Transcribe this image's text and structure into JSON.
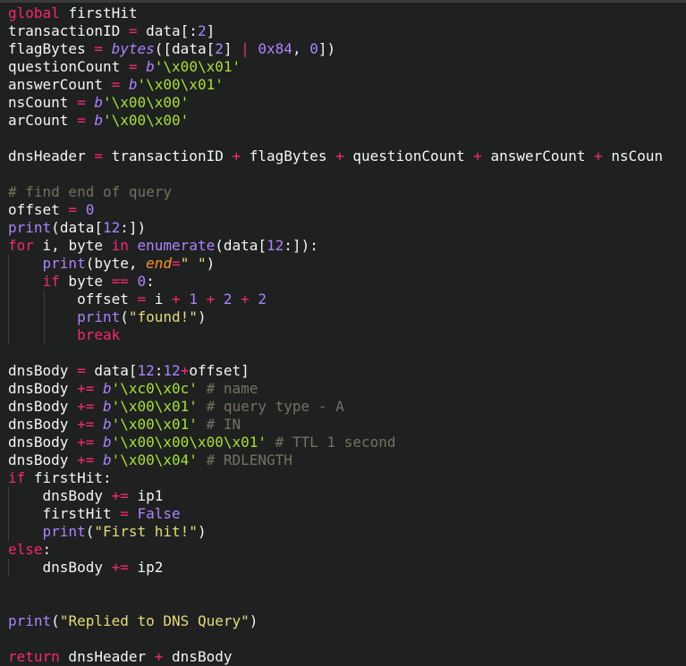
{
  "editor": {
    "language": "python",
    "theme": {
      "background": "#1f2121",
      "keyword": "#f92672",
      "identifier": "#f5f5f2",
      "number": "#ae81ff",
      "string": "#e6db74",
      "bytes_literal": "#a6e22e",
      "comment": "#75715e",
      "parameter": "#fd971f"
    },
    "lines": [
      {
        "indent": 0,
        "tokens": [
          {
            "t": "global",
            "c": "kw"
          },
          {
            "t": " ",
            "c": "pun"
          },
          {
            "t": "firstHit",
            "c": "id"
          }
        ]
      },
      {
        "indent": 0,
        "tokens": [
          {
            "t": "transactionID",
            "c": "id"
          },
          {
            "t": " = ",
            "c": "op"
          },
          {
            "t": "data",
            "c": "id"
          },
          {
            "t": "[:",
            "c": "pun"
          },
          {
            "t": "2",
            "c": "num"
          },
          {
            "t": "]",
            "c": "pun"
          }
        ]
      },
      {
        "indent": 0,
        "tokens": [
          {
            "t": "flagBytes",
            "c": "id"
          },
          {
            "t": " = ",
            "c": "op"
          },
          {
            "t": "bytes",
            "c": "bpre"
          },
          {
            "t": "([",
            "c": "pun"
          },
          {
            "t": "data",
            "c": "id"
          },
          {
            "t": "[",
            "c": "pun"
          },
          {
            "t": "2",
            "c": "num"
          },
          {
            "t": "] ",
            "c": "pun"
          },
          {
            "t": "|",
            "c": "op"
          },
          {
            "t": " ",
            "c": "pun"
          },
          {
            "t": "0x84",
            "c": "num"
          },
          {
            "t": ", ",
            "c": "pun"
          },
          {
            "t": "0",
            "c": "num"
          },
          {
            "t": "])",
            "c": "pun"
          }
        ]
      },
      {
        "indent": 0,
        "tokens": [
          {
            "t": "questionCount",
            "c": "id"
          },
          {
            "t": " = ",
            "c": "op"
          },
          {
            "t": "b",
            "c": "bpre"
          },
          {
            "t": "'\\x00\\x01'",
            "c": "bstr"
          }
        ]
      },
      {
        "indent": 0,
        "tokens": [
          {
            "t": "answerCount",
            "c": "id"
          },
          {
            "t": " = ",
            "c": "op"
          },
          {
            "t": "b",
            "c": "bpre"
          },
          {
            "t": "'\\x00\\x01'",
            "c": "bstr"
          }
        ]
      },
      {
        "indent": 0,
        "tokens": [
          {
            "t": "nsCount",
            "c": "id"
          },
          {
            "t": " = ",
            "c": "op"
          },
          {
            "t": "b",
            "c": "bpre"
          },
          {
            "t": "'\\x00\\x00'",
            "c": "bstr"
          }
        ]
      },
      {
        "indent": 0,
        "tokens": [
          {
            "t": "arCount",
            "c": "id"
          },
          {
            "t": " = ",
            "c": "op"
          },
          {
            "t": "b",
            "c": "bpre"
          },
          {
            "t": "'\\x00\\x00'",
            "c": "bstr"
          }
        ]
      },
      {
        "indent": 0,
        "tokens": []
      },
      {
        "indent": 0,
        "tokens": [
          {
            "t": "dnsHeader",
            "c": "id"
          },
          {
            "t": " = ",
            "c": "op"
          },
          {
            "t": "transactionID",
            "c": "id"
          },
          {
            "t": " + ",
            "c": "op"
          },
          {
            "t": "flagBytes",
            "c": "id"
          },
          {
            "t": " + ",
            "c": "op"
          },
          {
            "t": "questionCount",
            "c": "id"
          },
          {
            "t": " + ",
            "c": "op"
          },
          {
            "t": "answerCount",
            "c": "id"
          },
          {
            "t": " + ",
            "c": "op"
          },
          {
            "t": "nsCoun",
            "c": "id"
          }
        ]
      },
      {
        "indent": 0,
        "tokens": []
      },
      {
        "indent": 0,
        "tokens": [
          {
            "t": "# find end of query",
            "c": "cmt"
          }
        ]
      },
      {
        "indent": 0,
        "tokens": [
          {
            "t": "offset",
            "c": "id"
          },
          {
            "t": " = ",
            "c": "op"
          },
          {
            "t": "0",
            "c": "num"
          }
        ]
      },
      {
        "indent": 0,
        "tokens": [
          {
            "t": "print",
            "c": "fn"
          },
          {
            "t": "(",
            "c": "pun"
          },
          {
            "t": "data",
            "c": "id"
          },
          {
            "t": "[",
            "c": "pun"
          },
          {
            "t": "12",
            "c": "num"
          },
          {
            "t": ":])",
            "c": "pun"
          }
        ]
      },
      {
        "indent": 0,
        "tokens": [
          {
            "t": "for",
            "c": "kw"
          },
          {
            "t": " i, byte ",
            "c": "id"
          },
          {
            "t": "in",
            "c": "kw"
          },
          {
            "t": " ",
            "c": "pun"
          },
          {
            "t": "enumerate",
            "c": "fn"
          },
          {
            "t": "(",
            "c": "pun"
          },
          {
            "t": "data",
            "c": "id"
          },
          {
            "t": "[",
            "c": "pun"
          },
          {
            "t": "12",
            "c": "num"
          },
          {
            "t": ":]):",
            "c": "pun"
          }
        ]
      },
      {
        "indent": 1,
        "tokens": [
          {
            "t": "print",
            "c": "fn"
          },
          {
            "t": "(",
            "c": "pun"
          },
          {
            "t": "byte",
            "c": "id"
          },
          {
            "t": ", ",
            "c": "pun"
          },
          {
            "t": "end",
            "c": "param"
          },
          {
            "t": "=",
            "c": "op"
          },
          {
            "t": "\" \"",
            "c": "str"
          },
          {
            "t": ")",
            "c": "pun"
          }
        ]
      },
      {
        "indent": 1,
        "tokens": [
          {
            "t": "if",
            "c": "kw"
          },
          {
            "t": " byte ",
            "c": "id"
          },
          {
            "t": "==",
            "c": "op"
          },
          {
            "t": " ",
            "c": "pun"
          },
          {
            "t": "0",
            "c": "num"
          },
          {
            "t": ":",
            "c": "pun"
          }
        ]
      },
      {
        "indent": 2,
        "tokens": [
          {
            "t": "offset",
            "c": "id"
          },
          {
            "t": " = ",
            "c": "op"
          },
          {
            "t": "i",
            "c": "id"
          },
          {
            "t": " + ",
            "c": "op"
          },
          {
            "t": "1",
            "c": "num"
          },
          {
            "t": " + ",
            "c": "op"
          },
          {
            "t": "2",
            "c": "num"
          },
          {
            "t": " + ",
            "c": "op"
          },
          {
            "t": "2",
            "c": "num"
          }
        ]
      },
      {
        "indent": 2,
        "tokens": [
          {
            "t": "print",
            "c": "fn"
          },
          {
            "t": "(",
            "c": "pun"
          },
          {
            "t": "\"found!\"",
            "c": "str"
          },
          {
            "t": ")",
            "c": "pun"
          }
        ]
      },
      {
        "indent": 2,
        "tokens": [
          {
            "t": "break",
            "c": "kw"
          }
        ]
      },
      {
        "indent": 0,
        "tokens": []
      },
      {
        "indent": 0,
        "tokens": [
          {
            "t": "dnsBody",
            "c": "id"
          },
          {
            "t": " = ",
            "c": "op"
          },
          {
            "t": "data",
            "c": "id"
          },
          {
            "t": "[",
            "c": "pun"
          },
          {
            "t": "12",
            "c": "num"
          },
          {
            "t": ":",
            "c": "pun"
          },
          {
            "t": "12",
            "c": "num"
          },
          {
            "t": "+",
            "c": "op"
          },
          {
            "t": "offset",
            "c": "id"
          },
          {
            "t": "]",
            "c": "pun"
          }
        ]
      },
      {
        "indent": 0,
        "tokens": [
          {
            "t": "dnsBody",
            "c": "id"
          },
          {
            "t": " += ",
            "c": "op"
          },
          {
            "t": "b",
            "c": "bpre"
          },
          {
            "t": "'\\xc0\\x0c'",
            "c": "bstr"
          },
          {
            "t": " # name",
            "c": "cmt"
          }
        ]
      },
      {
        "indent": 0,
        "tokens": [
          {
            "t": "dnsBody",
            "c": "id"
          },
          {
            "t": " += ",
            "c": "op"
          },
          {
            "t": "b",
            "c": "bpre"
          },
          {
            "t": "'\\x00\\x01'",
            "c": "bstr"
          },
          {
            "t": " # query type - A",
            "c": "cmt"
          }
        ]
      },
      {
        "indent": 0,
        "tokens": [
          {
            "t": "dnsBody",
            "c": "id"
          },
          {
            "t": " += ",
            "c": "op"
          },
          {
            "t": "b",
            "c": "bpre"
          },
          {
            "t": "'\\x00\\x01'",
            "c": "bstr"
          },
          {
            "t": " # IN",
            "c": "cmt"
          }
        ]
      },
      {
        "indent": 0,
        "tokens": [
          {
            "t": "dnsBody",
            "c": "id"
          },
          {
            "t": " += ",
            "c": "op"
          },
          {
            "t": "b",
            "c": "bpre"
          },
          {
            "t": "'\\x00\\x00\\x00\\x01'",
            "c": "bstr"
          },
          {
            "t": " # TTL 1 second",
            "c": "cmt"
          }
        ]
      },
      {
        "indent": 0,
        "tokens": [
          {
            "t": "dnsBody",
            "c": "id"
          },
          {
            "t": " += ",
            "c": "op"
          },
          {
            "t": "b",
            "c": "bpre"
          },
          {
            "t": "'\\x00\\x04'",
            "c": "bstr"
          },
          {
            "t": " # RDLENGTH",
            "c": "cmt"
          }
        ]
      },
      {
        "indent": 0,
        "tokens": [
          {
            "t": "if",
            "c": "kw"
          },
          {
            "t": " firstHit:",
            "c": "id"
          }
        ]
      },
      {
        "indent": 1,
        "tokens": [
          {
            "t": "dnsBody",
            "c": "id"
          },
          {
            "t": " += ",
            "c": "op"
          },
          {
            "t": "ip1",
            "c": "id"
          }
        ]
      },
      {
        "indent": 1,
        "tokens": [
          {
            "t": "firstHit",
            "c": "id"
          },
          {
            "t": " = ",
            "c": "op"
          },
          {
            "t": "False",
            "c": "const"
          }
        ]
      },
      {
        "indent": 1,
        "tokens": [
          {
            "t": "print",
            "c": "fn"
          },
          {
            "t": "(",
            "c": "pun"
          },
          {
            "t": "\"First hit!\"",
            "c": "str"
          },
          {
            "t": ")",
            "c": "pun"
          }
        ]
      },
      {
        "indent": 0,
        "tokens": [
          {
            "t": "else",
            "c": "kw"
          },
          {
            "t": ":",
            "c": "pun"
          }
        ]
      },
      {
        "indent": 1,
        "tokens": [
          {
            "t": "dnsBody",
            "c": "id"
          },
          {
            "t": " += ",
            "c": "op"
          },
          {
            "t": "ip2",
            "c": "id"
          }
        ]
      },
      {
        "indent": 0,
        "tokens": []
      },
      {
        "indent": 0,
        "tokens": []
      },
      {
        "indent": 0,
        "tokens": [
          {
            "t": "print",
            "c": "fn"
          },
          {
            "t": "(",
            "c": "pun"
          },
          {
            "t": "\"Replied to DNS Query\"",
            "c": "str"
          },
          {
            "t": ")",
            "c": "pun"
          }
        ]
      },
      {
        "indent": 0,
        "tokens": []
      },
      {
        "indent": 0,
        "tokens": [
          {
            "t": "return",
            "c": "kw"
          },
          {
            "t": " dnsHeader ",
            "c": "id"
          },
          {
            "t": "+",
            "c": "op"
          },
          {
            "t": " dnsBody",
            "c": "id"
          }
        ]
      }
    ]
  }
}
